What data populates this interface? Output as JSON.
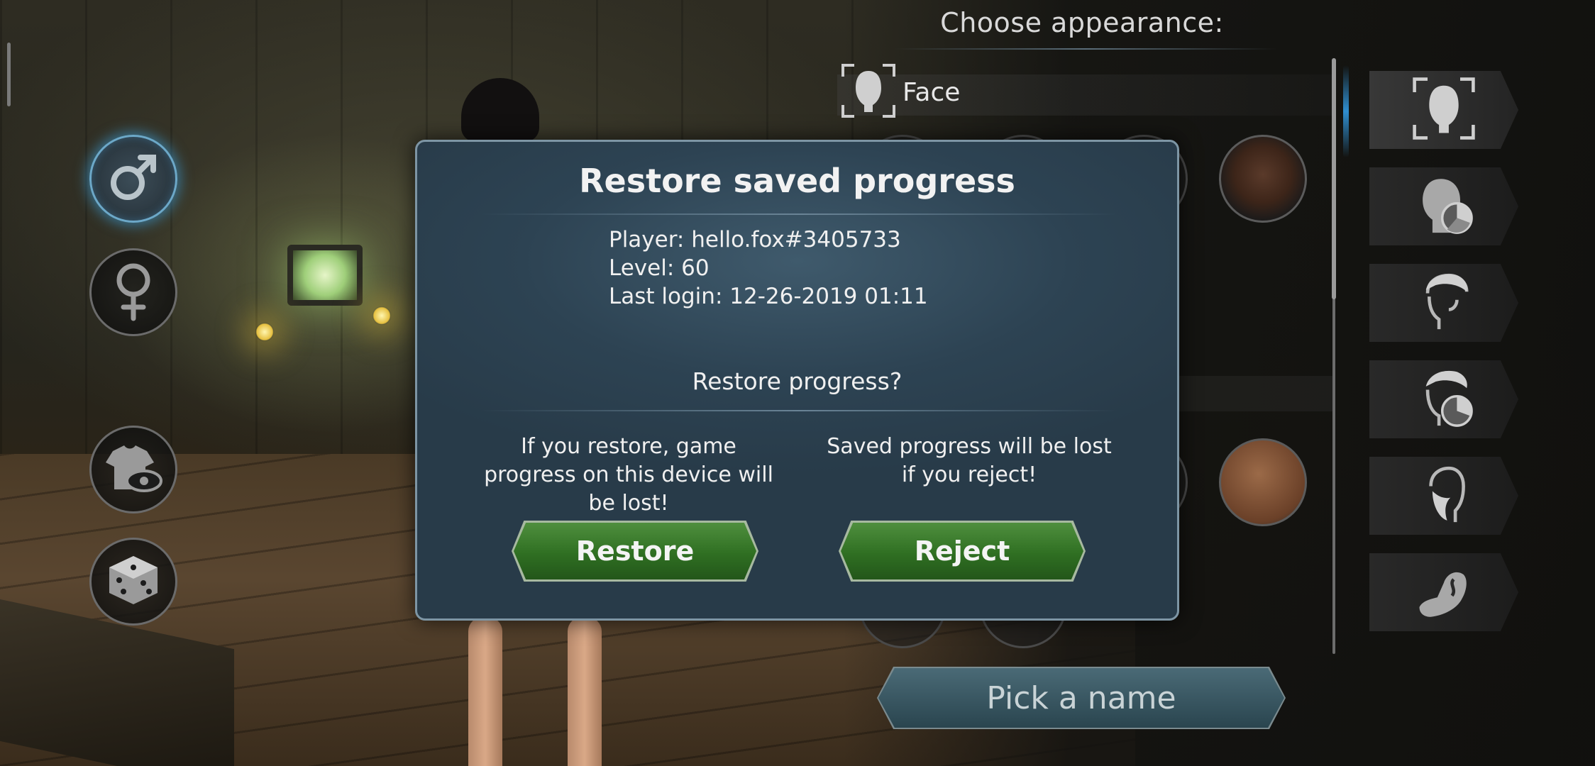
{
  "header": {
    "title": "Choose appearance:"
  },
  "category": {
    "label": "Face"
  },
  "left_buttons": [
    {
      "name": "male-gender",
      "icon": "male-symbol-icon",
      "active": true
    },
    {
      "name": "female-gender",
      "icon": "female-symbol-icon",
      "active": false
    },
    {
      "name": "clothing-visibility",
      "icon": "shirt-eye-icon",
      "active": false
    },
    {
      "name": "randomize",
      "icon": "dice-icon",
      "active": false
    }
  ],
  "right_tabs": [
    {
      "icon": "face-scan-icon",
      "active": true
    },
    {
      "icon": "head-color-icon"
    },
    {
      "icon": "hair-icon"
    },
    {
      "icon": "hair-color-icon"
    },
    {
      "icon": "beard-icon"
    },
    {
      "icon": "tattoo-arm-icon"
    }
  ],
  "modal": {
    "title": "Restore saved progress",
    "player_line": "Player: hello.fox#3405733",
    "level_line": "Level: 60",
    "last_login_line": "Last login: 12-26-2019 01:11",
    "question": "Restore progress?",
    "restore_warning": "If you restore, game progress on this device will be lost!",
    "reject_warning": "Saved progress will be lost if you reject!",
    "restore_label": "Restore",
    "reject_label": "Reject"
  },
  "pick_name": {
    "label": "Pick a name"
  },
  "colors": {
    "accent_blue": "#2f8ed0",
    "button_green": "#2f6f22",
    "modal_bg": "#2d4353"
  }
}
